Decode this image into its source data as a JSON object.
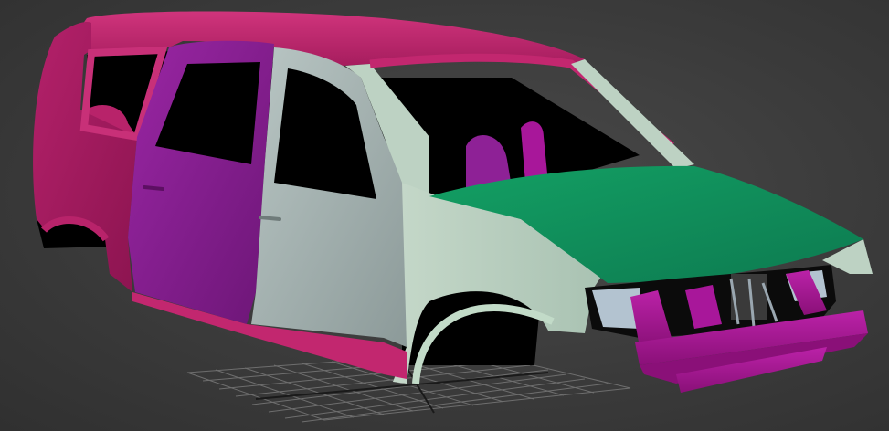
{
  "viewport": {
    "background": "#3d3d3d",
    "grid_color": "#6e6e6e",
    "grid_axis_color": "#1a1a1a"
  },
  "car_body": {
    "roof_color": "#c2276f",
    "rear_quarter_color": "#b8236a",
    "rear_door_color": "#8e2196",
    "front_door_color": "#a9b7b5",
    "front_fender_color": "#bdd2c3",
    "hood_color": "#10905e",
    "front_bumper_color": "#a8179a",
    "interior_color": "#000000"
  }
}
